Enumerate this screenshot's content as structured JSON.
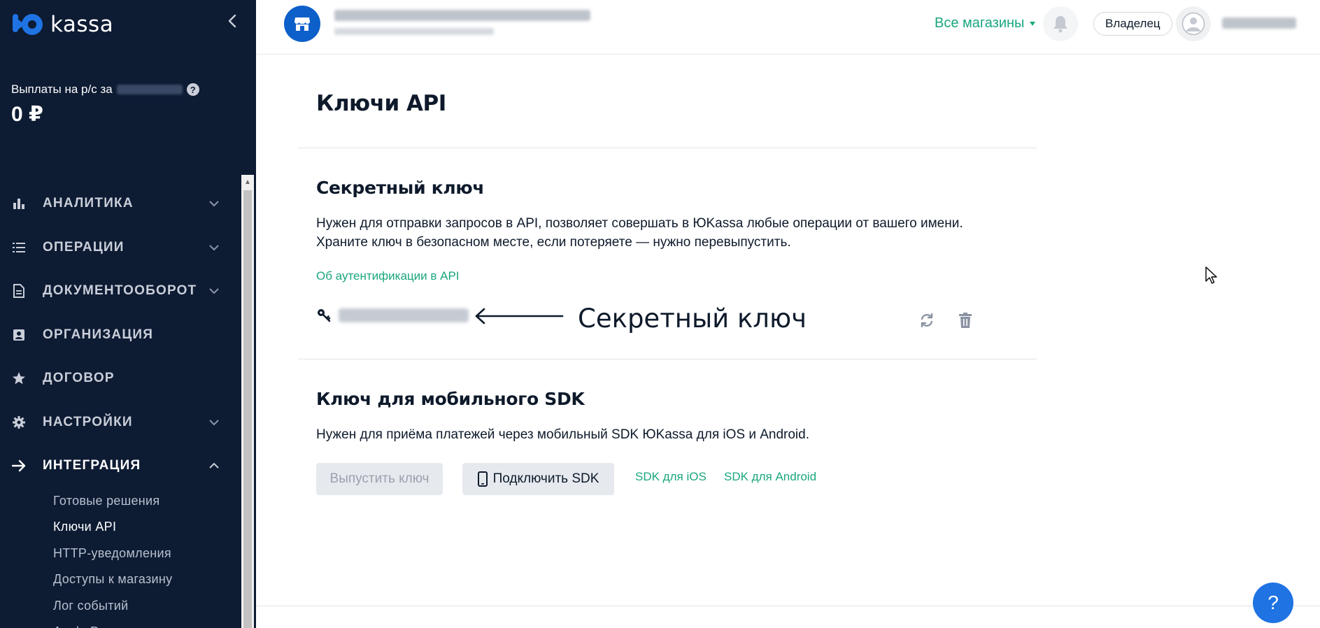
{
  "app": {
    "logo_text": "kassa"
  },
  "sidebar": {
    "payout_label": "Выплаты на р/с за",
    "payout_value": "0 ₽",
    "items": [
      {
        "label": "АНАЛИТИКА",
        "icon": "bar-chart-icon",
        "expandable": true
      },
      {
        "label": "ОПЕРАЦИИ",
        "icon": "list-icon",
        "expandable": true
      },
      {
        "label": "ДОКУМЕНТООБОРОТ",
        "icon": "document-icon",
        "expandable": true
      },
      {
        "label": "ОРГАНИЗАЦИЯ",
        "icon": "id-card-icon",
        "expandable": false
      },
      {
        "label": "ДОГОВОР",
        "icon": "star-icon",
        "expandable": false
      },
      {
        "label": "НАСТРОЙКИ",
        "icon": "gear-icon",
        "expandable": true
      },
      {
        "label": "ИНТЕГРАЦИЯ",
        "icon": "arrow-right-icon",
        "expandable": true,
        "expanded": true
      }
    ],
    "sub_items": [
      {
        "label": "Готовые решения"
      },
      {
        "label": "Ключи API",
        "active": true
      },
      {
        "label": "HTTP-уведомления"
      },
      {
        "label": "Доступы к магазину"
      },
      {
        "label": "Лог событий"
      },
      {
        "label": "Apple Pay"
      }
    ]
  },
  "header": {
    "stores_label": "Все магазины",
    "role_label": "Владелец"
  },
  "main": {
    "page_title": "Ключи API",
    "secret": {
      "title": "Секретный ключ",
      "text_line1": "Нужен для отправки запросов в API, позволяет совершать в ЮKassa любые операции от вашего имени.",
      "text_line2": "Храните ключ в безопасном месте, если потеряете — нужно перевыпустить.",
      "auth_link": "Об аутентификации в API",
      "annotation": "Секретный ключ"
    },
    "sdk": {
      "title": "Ключ для мобильного SDK",
      "text": "Нужен для приёма платежей через мобильный SDK ЮKassa для iOS и Android.",
      "issue_button": "Выпустить ключ",
      "connect_button": "Подключить SDK",
      "ios_link": "SDK для iOS",
      "android_link": "SDK для Android"
    },
    "help_label": "?"
  },
  "colors": {
    "sidebar_bg": "#0d1b33",
    "accent_green": "#1aa67e",
    "brand_blue": "#0d5fc9",
    "help_blue": "#1f73e3"
  }
}
